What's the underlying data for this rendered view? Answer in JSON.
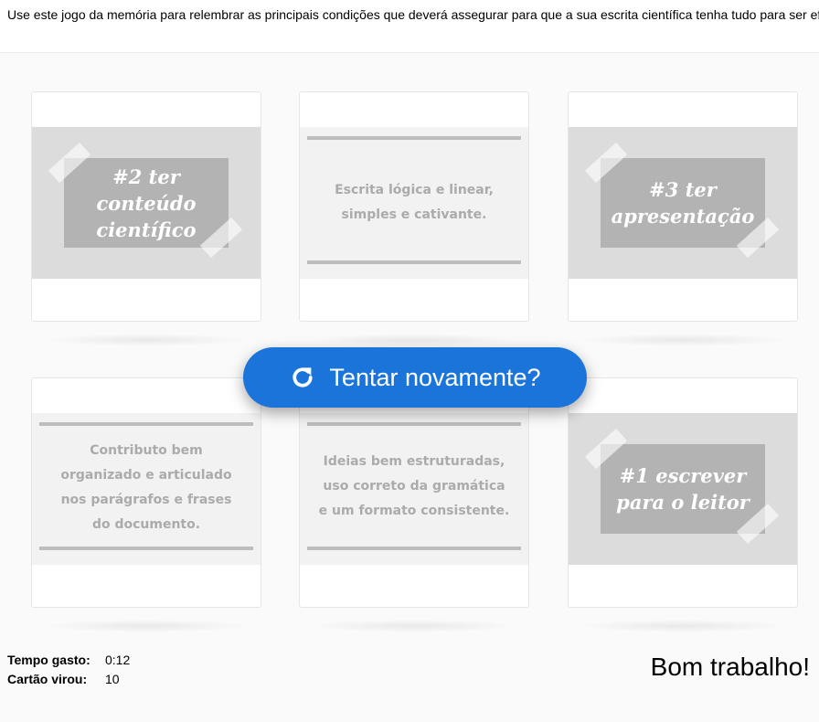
{
  "intro": "Use este jogo da memória para relembrar as principais condições que deverá assegurar para que a sua escrita científica tenha tudo para ser eficaz.",
  "cards": {
    "c1": {
      "lines": [
        "#2 ter",
        "conteúdo",
        "científico"
      ]
    },
    "c2": {
      "lines": [
        "Escrita lógica e linear,",
        "simples e cativante."
      ]
    },
    "c3": {
      "lines": [
        "#3 ter",
        "apresentação"
      ]
    },
    "c4": {
      "lines": [
        "Contributo bem",
        "organizado e articulado",
        "nos parágrafos e frases",
        "do documento."
      ]
    },
    "c5": {
      "lines": [
        "Ideias bem estruturadas,",
        "uso correto da gramática",
        "e um formato consistente."
      ]
    },
    "c6": {
      "lines": [
        "#1 escrever",
        "para o leitor"
      ]
    }
  },
  "retry_button": {
    "label": "Tentar novamente?",
    "icon": "refresh-icon"
  },
  "stats": {
    "time_label": "Tempo gasto:",
    "time_value": "0:12",
    "flips_label": "Cartão virou:",
    "flips_value": "10"
  },
  "result": "Bom trabalho!",
  "colors": {
    "accent": "#1a74d9",
    "plaque": "#b3b3b3"
  }
}
